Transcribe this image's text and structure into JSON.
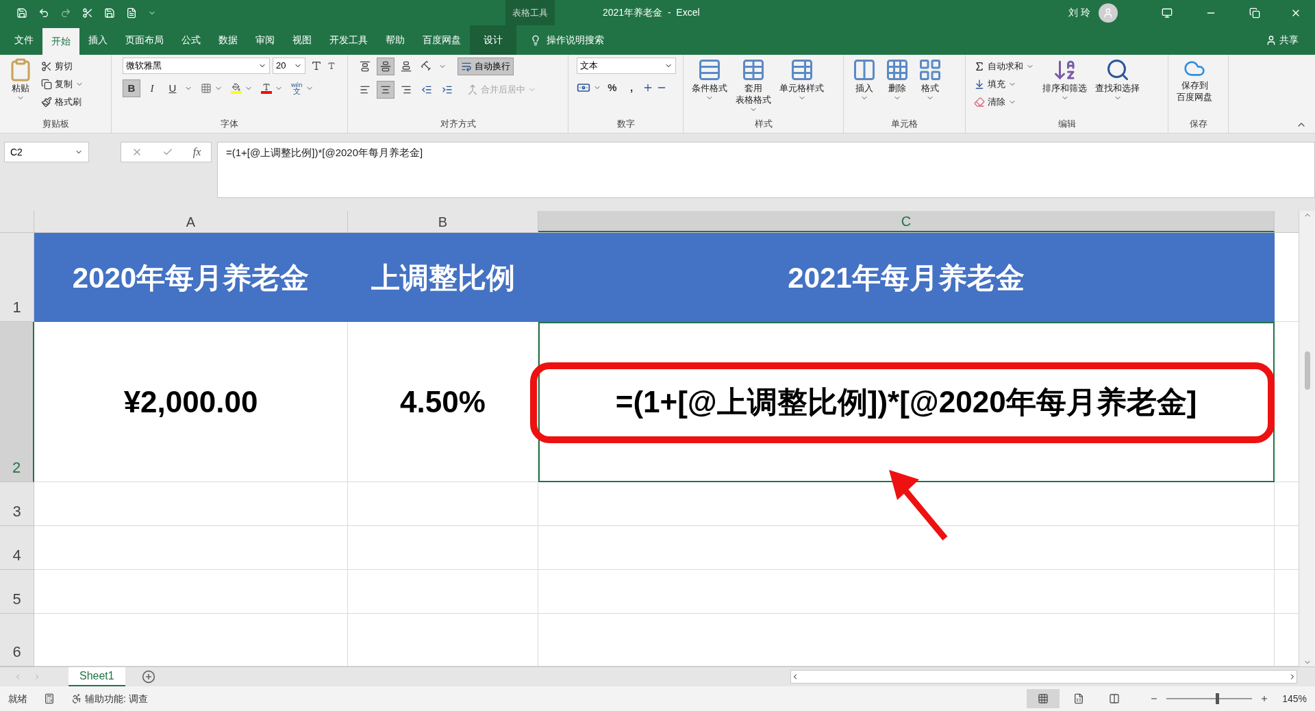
{
  "window": {
    "contextual_label": "表格工具",
    "title": "2021年养老金  -  Excel",
    "user": "刘 玲"
  },
  "menu_tabs": [
    {
      "label": "文件",
      "selected": false,
      "kind": "normal"
    },
    {
      "label": "开始",
      "selected": true,
      "kind": "normal"
    },
    {
      "label": "插入",
      "selected": false,
      "kind": "normal"
    },
    {
      "label": "页面布局",
      "selected": false,
      "kind": "normal"
    },
    {
      "label": "公式",
      "selected": false,
      "kind": "normal"
    },
    {
      "label": "数据",
      "selected": false,
      "kind": "normal"
    },
    {
      "label": "审阅",
      "selected": false,
      "kind": "normal"
    },
    {
      "label": "视图",
      "selected": false,
      "kind": "normal"
    },
    {
      "label": "开发工具",
      "selected": false,
      "kind": "normal"
    },
    {
      "label": "帮助",
      "selected": false,
      "kind": "normal"
    },
    {
      "label": "百度网盘",
      "selected": false,
      "kind": "normal"
    },
    {
      "label": "设计",
      "selected": false,
      "kind": "contextual"
    }
  ],
  "tell_me": "操作说明搜索",
  "share": "共享",
  "ribbon": {
    "clipboard": {
      "label": "剪贴板",
      "paste": "粘贴",
      "items": [
        "剪切",
        "复制",
        "格式刷"
      ]
    },
    "font": {
      "label": "字体",
      "family": "微软雅黑",
      "size": "20",
      "styles": [
        {
          "label": "B",
          "selected": true
        },
        {
          "label": "I",
          "selected": false
        },
        {
          "label": "U",
          "selected": false
        }
      ],
      "phonetic": "wén",
      "phonetic_char": "文"
    },
    "alignment": {
      "label": "对齐方式",
      "vertical": [
        {
          "selected": false
        },
        {
          "selected": true
        },
        {
          "selected": false
        }
      ],
      "horizontal": [
        {
          "selected": false
        },
        {
          "selected": true
        },
        {
          "selected": false
        }
      ],
      "wrap": {
        "label": "自动换行",
        "selected": true
      },
      "merge": {
        "label": "合并后居中",
        "disabled": true
      }
    },
    "number": {
      "label": "数字",
      "format": "文本",
      "symbols": [
        "%",
        ","
      ]
    },
    "styles": {
      "label": "样式",
      "items": [
        [
          "条件格式"
        ],
        [
          "套用",
          "表格格式"
        ],
        [
          "单元格样式"
        ]
      ]
    },
    "cells": {
      "label": "单元格",
      "items": [
        "插入",
        "删除",
        "格式"
      ]
    },
    "editing": {
      "label": "编辑",
      "small": [
        "自动求和",
        "填充",
        "清除"
      ],
      "large": [
        "排序和筛选",
        "查找和选择"
      ]
    },
    "save": {
      "label": "保存",
      "lines": [
        "保存到",
        "百度网盘"
      ]
    }
  },
  "formula_bar": {
    "name_box": "C2",
    "function_label": "fx",
    "formula": "=(1+[@上调整比例])*[@2020年每月养老金]"
  },
  "sheet": {
    "columns": [
      {
        "label": "A",
        "selected": false
      },
      {
        "label": "B",
        "selected": false
      },
      {
        "label": "C",
        "selected": true
      }
    ],
    "rows": [
      {
        "label": "1",
        "selected": false,
        "kind": "header",
        "cells": [
          {
            "text": "2020年每月养老金",
            "selected": false
          },
          {
            "text": "上调整比例",
            "selected": false
          },
          {
            "text": "2021年每月养老金",
            "selected": false
          }
        ]
      },
      {
        "label": "2",
        "selected": true,
        "kind": "data",
        "cells": [
          {
            "text": "¥2,000.00",
            "selected": false
          },
          {
            "text": "4.50%",
            "selected": false
          },
          {
            "text": "=(1+[@上调整比例])*[@2020年每月养老金]",
            "selected": true
          }
        ]
      },
      {
        "label": "3",
        "selected": false,
        "kind": "empty"
      },
      {
        "label": "4",
        "selected": false,
        "kind": "empty"
      },
      {
        "label": "5",
        "selected": false,
        "kind": "empty"
      },
      {
        "label": "6",
        "selected": false,
        "kind": "empty"
      }
    ]
  },
  "sheet_tabs": [
    {
      "label": "Sheet1",
      "selected": true
    }
  ],
  "status_bar": {
    "status": "就绪",
    "accessibility": "辅助功能: 调查",
    "views": [
      {
        "kind": "normal",
        "selected": true
      },
      {
        "kind": "page_layout",
        "selected": false
      },
      {
        "kind": "page_break",
        "selected": false
      }
    ],
    "zoom": {
      "level": 0.59,
      "reading": "145%"
    }
  }
}
